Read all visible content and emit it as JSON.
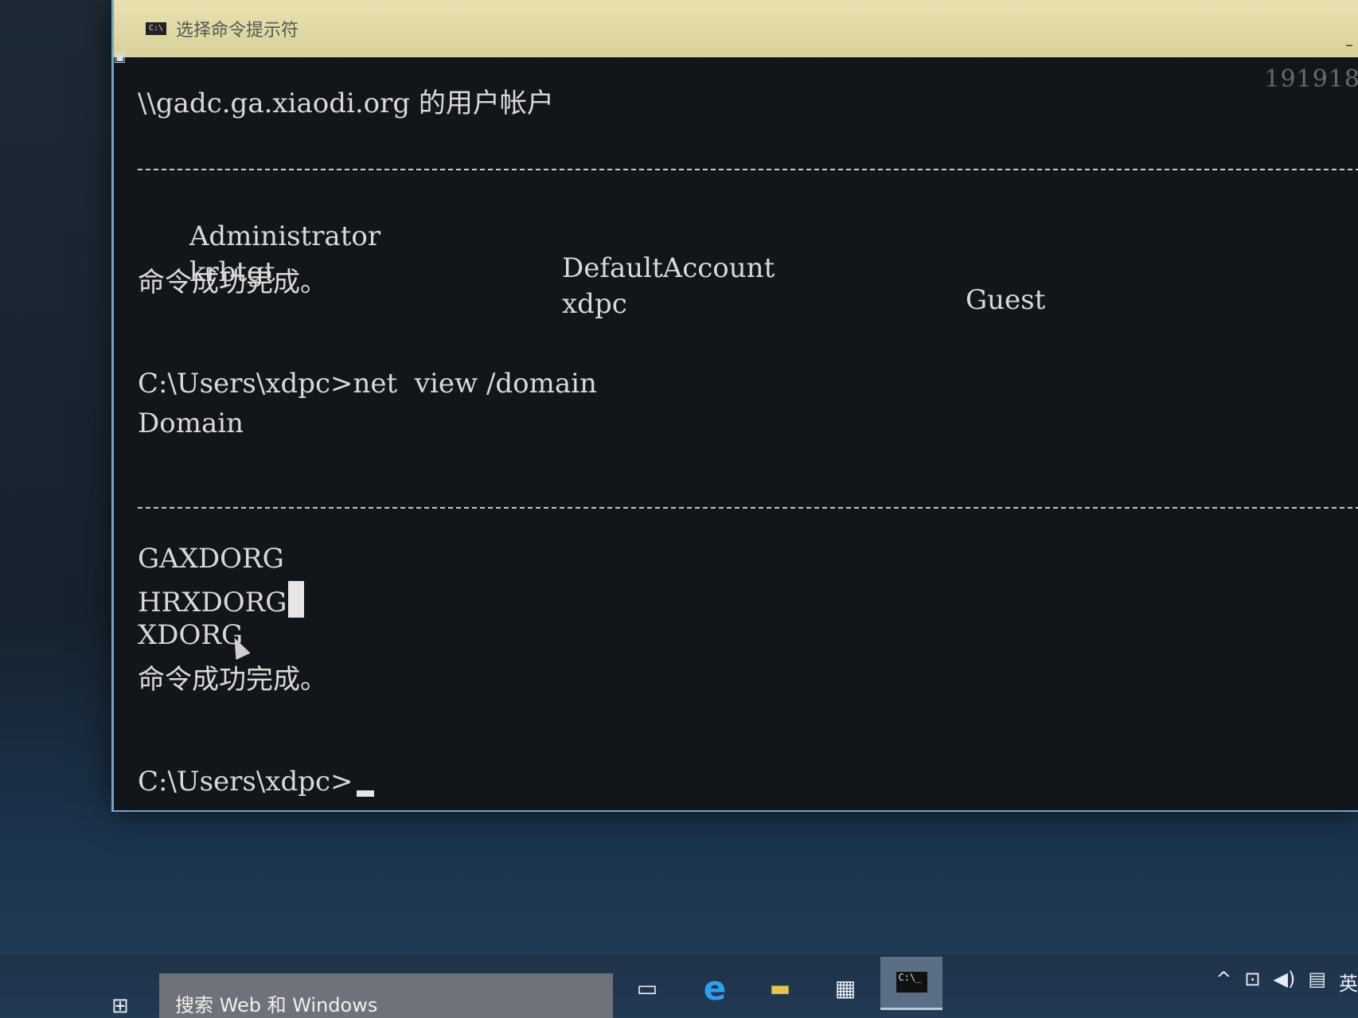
{
  "window": {
    "title": "选择命令提示符",
    "icon_label": "C:\\",
    "watermark": "191918"
  },
  "console": {
    "header": "\\\\gadc.ga.xiaodi.org 的用户帐户",
    "accounts": [
      [
        "Administrator",
        "DefaultAccount",
        "Guest"
      ],
      [
        "krbtgt",
        "xdpc",
        ""
      ]
    ],
    "success1": "命令成功完成。",
    "command": "C:\\Users\\xdpc>net  view /domain",
    "domain_header": "Domain",
    "domains": [
      "GAXDORG",
      "HRXDORG",
      "XDORG"
    ],
    "success2": "命令成功完成。",
    "prompt": "C:\\Users\\xdpc>"
  },
  "taskbar": {
    "search_placeholder": "搜索 Web 和 Windows",
    "icons": [
      "task-view-icon",
      "edge-icon",
      "file-explorer-icon",
      "store-icon",
      "cmd-icon"
    ],
    "tray_lang": "英"
  }
}
